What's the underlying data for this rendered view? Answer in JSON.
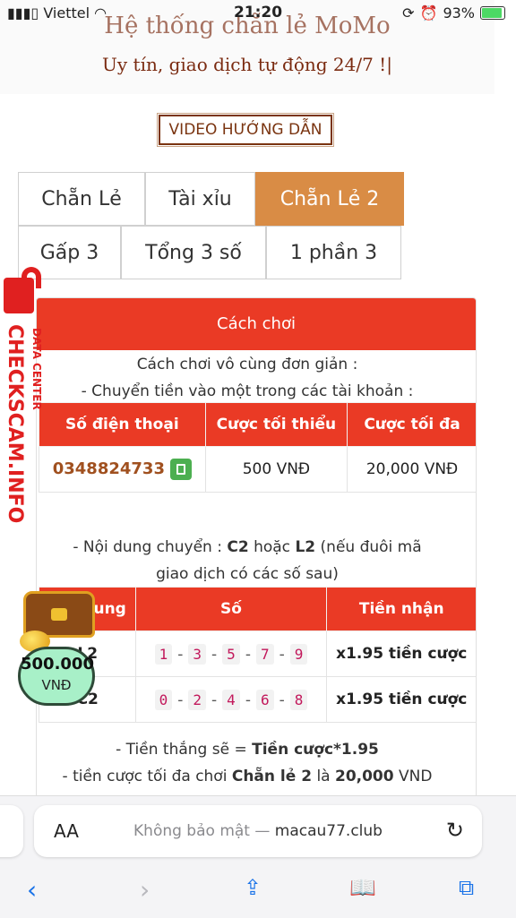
{
  "status": {
    "carrier": "Viettel",
    "time": "21:20",
    "battery": "93%"
  },
  "hero": {
    "title": "Hệ thống chẵn lẻ MoMo",
    "slogan": "Uy tín, giao dịch tự động 24/7 !|"
  },
  "video_button": "VIDEO HƯỚNG DẪN",
  "tabs": [
    {
      "label": "Chẵn Lẻ",
      "active": false
    },
    {
      "label": "Tài xỉu",
      "active": false
    },
    {
      "label": "Chẵn Lẻ 2",
      "active": true
    },
    {
      "label": "Gấp 3",
      "active": false
    },
    {
      "label": "Tổng 3 số",
      "active": false
    },
    {
      "label": "1 phần 3",
      "active": false
    }
  ],
  "card": {
    "header": "Cách chơi",
    "intro": "Cách chơi vô cùng đơn giản :",
    "transfer_note": "- Chuyển tiền vào một trong các tài khoản :",
    "accounts_table": {
      "headers": [
        "Số điện thoại",
        "Cược tối thiểu",
        "Cược tối đa"
      ],
      "rows": [
        {
          "phone": "0348824733",
          "min": "500 VNĐ",
          "max": "20,000 VNĐ"
        }
      ]
    },
    "content_note": {
      "prefix": "- Nội dung chuyển :",
      "c2": "C2",
      "or": "hoặc",
      "l2": "L2",
      "suffix": "(nếu đuôi mã",
      "line2": "giao dịch có các số sau)"
    },
    "rules_table": {
      "headers": [
        "Nội dung",
        "Số",
        "Tiền nhận"
      ],
      "rows": [
        {
          "content": "L2",
          "digits": [
            "1",
            "3",
            "5",
            "7",
            "9"
          ],
          "payout": "x1.95 tiền cược"
        },
        {
          "content": "C2",
          "digits": [
            "0",
            "2",
            "4",
            "6",
            "8"
          ],
          "payout": "x1.95 tiền cược"
        }
      ]
    },
    "win_note": {
      "prefix": "- Tiền thắng sẽ =",
      "bold": "Tiền cược*1.95"
    },
    "max_note": {
      "prefix": "- tiền cược tối đa chơi",
      "game": "Chẵn lẻ 2",
      "mid": "là",
      "amount": "20,000",
      "suffix": "VND"
    }
  },
  "checkscam": {
    "brand": "CHECKSCAM.INFO",
    "sub": "DATA CENTER"
  },
  "promo": {
    "amount": "500.000",
    "currency": "VNĐ"
  },
  "browser": {
    "aa": "AA",
    "not_secure": "Không bảo mật —",
    "domain": "macau77.club"
  },
  "colors": {
    "accent": "#ea3a25",
    "tab_active": "#d98c45",
    "link": "#1a73e8"
  }
}
